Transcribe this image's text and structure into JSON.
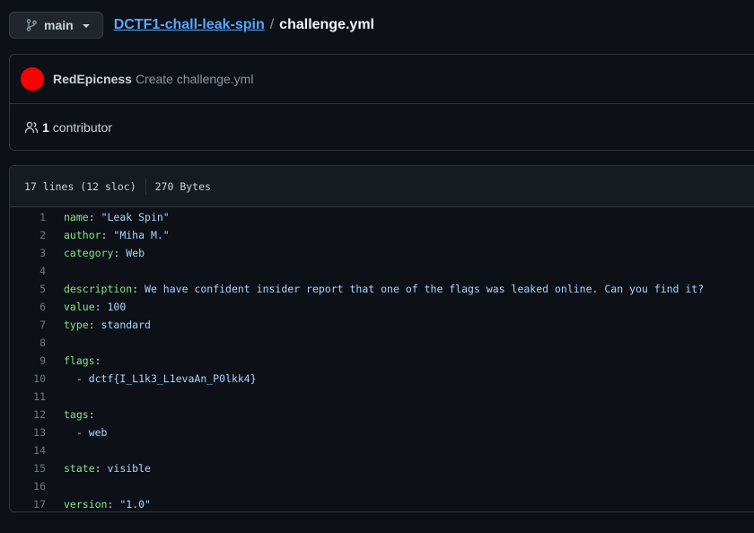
{
  "branch": {
    "label": "main",
    "icon": "git-branch-icon"
  },
  "breadcrumb": {
    "repo": "DCTF1-chall-leak-spin",
    "separator": "/",
    "file": "challenge.yml"
  },
  "commit": {
    "author": "RedEpicness",
    "message": "Create challenge.yml",
    "avatar_color": "#ff0000"
  },
  "contributors": {
    "count": "1",
    "label": "contributor",
    "icon": "people-icon"
  },
  "file_info": {
    "lines": "17 lines (12 sloc)",
    "size": "270 Bytes"
  },
  "code": [
    {
      "num": "1",
      "key": "name",
      "sep": ": ",
      "val": "\"Leak Spin\""
    },
    {
      "num": "2",
      "key": "author",
      "sep": ": ",
      "val": "\"Miha M.\""
    },
    {
      "num": "3",
      "key": "category",
      "sep": ": ",
      "val": "Web"
    },
    {
      "num": "4",
      "key": "",
      "sep": "",
      "val": ""
    },
    {
      "num": "5",
      "key": "description",
      "sep": ": ",
      "val": "We have confident insider report that one of the flags was leaked online. Can you find it?"
    },
    {
      "num": "6",
      "key": "value",
      "sep": ": ",
      "val": "100"
    },
    {
      "num": "7",
      "key": "type",
      "sep": ": ",
      "val": "standard"
    },
    {
      "num": "8",
      "key": "",
      "sep": "",
      "val": ""
    },
    {
      "num": "9",
      "key": "flags",
      "sep": ":",
      "val": ""
    },
    {
      "num": "10",
      "key": "",
      "sep": "  - ",
      "val": "dctf{I_L1k3_L1evaAn_P0lkk4}"
    },
    {
      "num": "11",
      "key": "",
      "sep": "",
      "val": ""
    },
    {
      "num": "12",
      "key": "tags",
      "sep": ":",
      "val": ""
    },
    {
      "num": "13",
      "key": "",
      "sep": "  - ",
      "val": "web"
    },
    {
      "num": "14",
      "key": "",
      "sep": "",
      "val": ""
    },
    {
      "num": "15",
      "key": "state",
      "sep": ": ",
      "val": "visible"
    },
    {
      "num": "16",
      "key": "",
      "sep": "",
      "val": ""
    },
    {
      "num": "17",
      "key": "version",
      "sep": ": ",
      "val": "\"1.0\""
    }
  ]
}
